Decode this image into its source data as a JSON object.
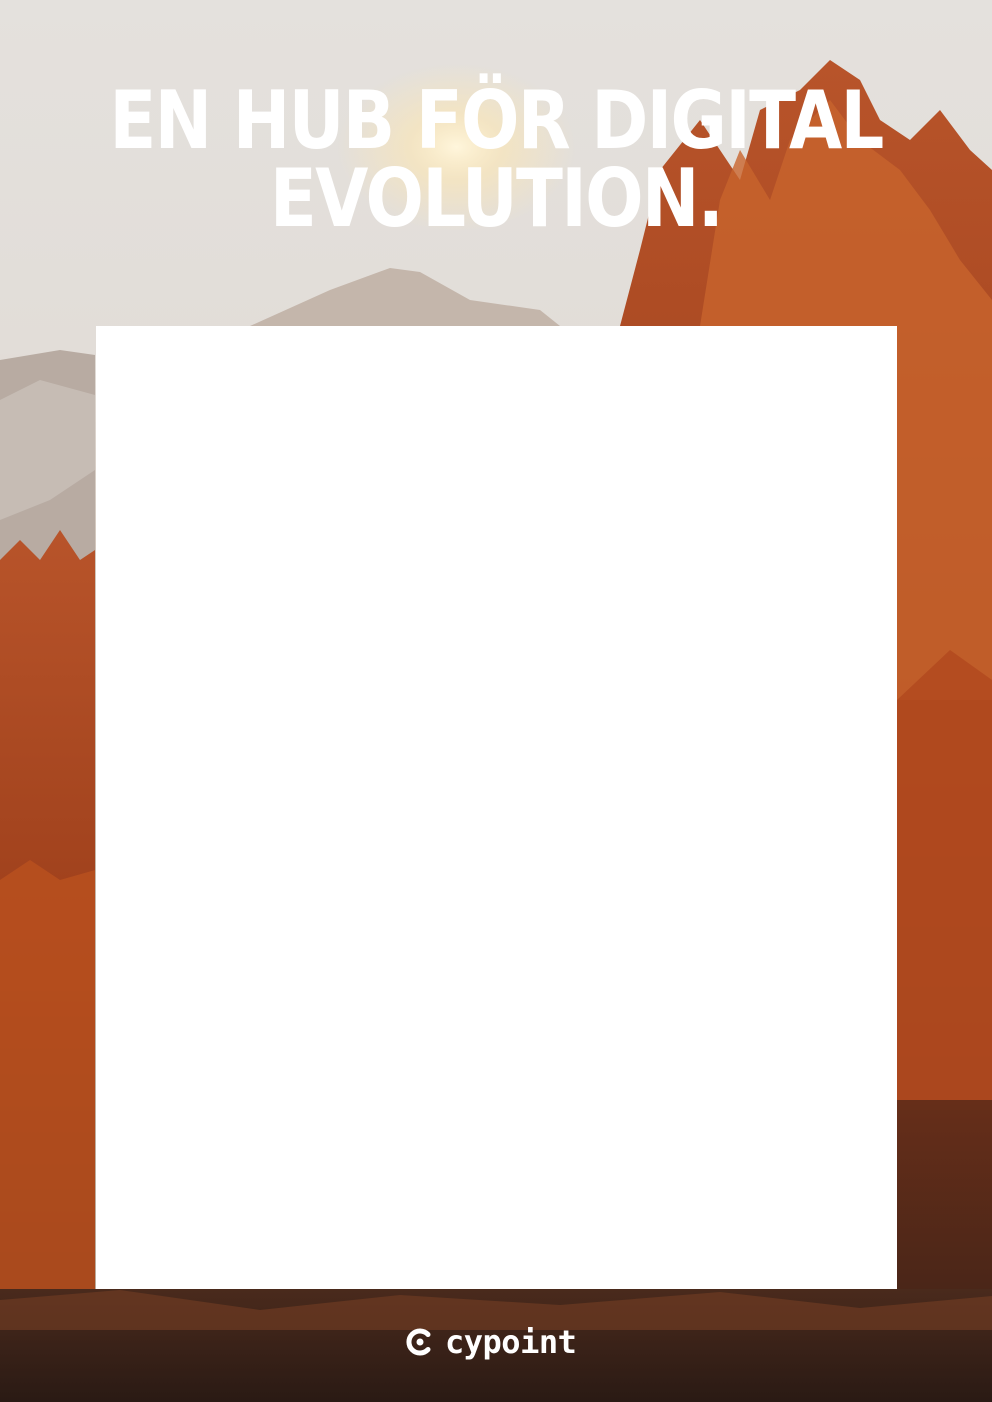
{
  "headline": {
    "line1": "EN HUB FÖR DIGITAL",
    "line2": "EVOLUTION."
  },
  "logo": {
    "text": "cypoint",
    "icon": "c-ring-dot-icon"
  },
  "colors": {
    "sky": "#e6e2de",
    "forest_dark": "#2b1a12",
    "foliage": "#c4561f",
    "panel": "#ffffff"
  }
}
